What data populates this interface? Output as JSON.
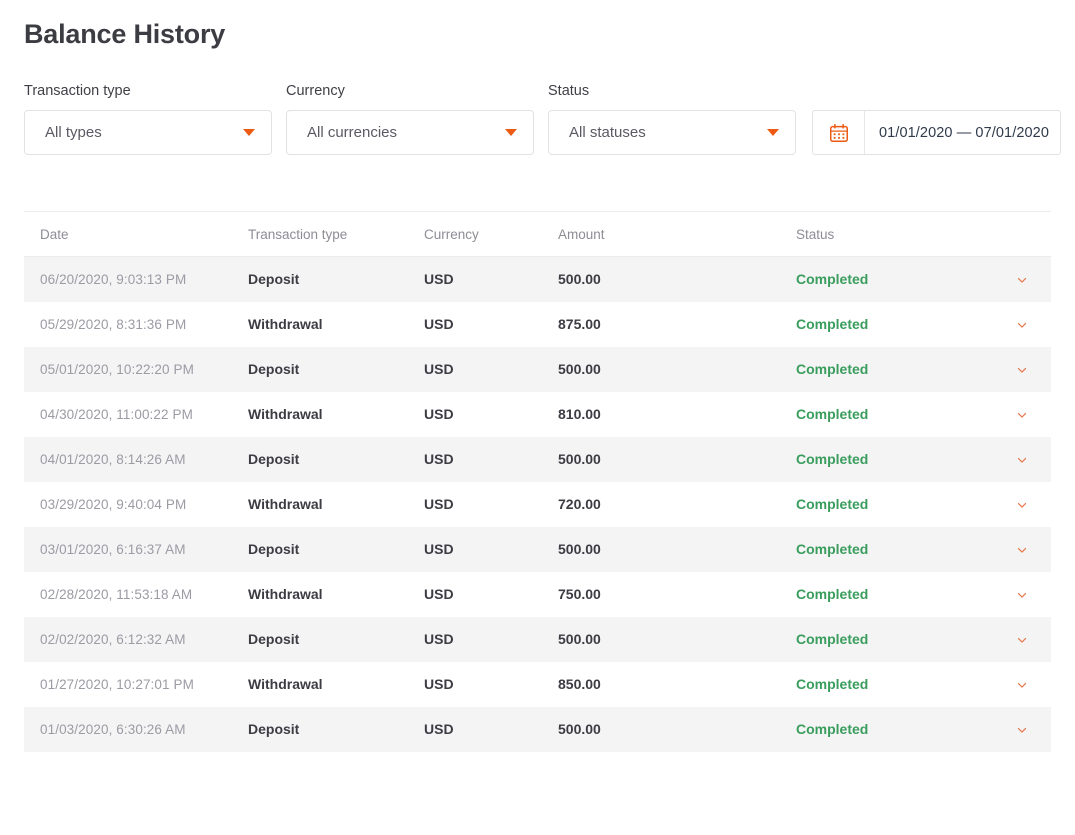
{
  "page": {
    "title": "Balance History"
  },
  "colors": {
    "accent_orange": "#ec5a13",
    "status_green": "#3a9d5d",
    "title_dark": "#3c3c43",
    "row_stripe": "#f4f4f5",
    "muted_text": "#9b9ba3"
  },
  "filters": {
    "transaction_type": {
      "label": "Transaction type",
      "value": "All types",
      "icon": "caret-down-icon"
    },
    "currency": {
      "label": "Currency",
      "value": "All currencies",
      "icon": "caret-down-icon"
    },
    "status": {
      "label": "Status",
      "value": "All statuses",
      "icon": "caret-down-icon"
    },
    "date_range": {
      "value": "01/01/2020 — 07/01/2020",
      "icon": "calendar-icon"
    }
  },
  "table": {
    "columns": [
      "Date",
      "Transaction type",
      "Currency",
      "Amount",
      "Status"
    ],
    "row_expand_icon": "chevron-down-icon",
    "rows": [
      {
        "date": "06/20/2020, 9:03:13 PM",
        "type": "Deposit",
        "currency": "USD",
        "amount": "500.00",
        "status": "Completed"
      },
      {
        "date": "05/29/2020, 8:31:36 PM",
        "type": "Withdrawal",
        "currency": "USD",
        "amount": "875.00",
        "status": "Completed"
      },
      {
        "date": "05/01/2020, 10:22:20 PM",
        "type": "Deposit",
        "currency": "USD",
        "amount": "500.00",
        "status": "Completed"
      },
      {
        "date": "04/30/2020, 11:00:22 PM",
        "type": "Withdrawal",
        "currency": "USD",
        "amount": "810.00",
        "status": "Completed"
      },
      {
        "date": "04/01/2020, 8:14:26 AM",
        "type": "Deposit",
        "currency": "USD",
        "amount": "500.00",
        "status": "Completed"
      },
      {
        "date": "03/29/2020, 9:40:04 PM",
        "type": "Withdrawal",
        "currency": "USD",
        "amount": "720.00",
        "status": "Completed"
      },
      {
        "date": "03/01/2020, 6:16:37 AM",
        "type": "Deposit",
        "currency": "USD",
        "amount": "500.00",
        "status": "Completed"
      },
      {
        "date": "02/28/2020, 11:53:18 AM",
        "type": "Withdrawal",
        "currency": "USD",
        "amount": "750.00",
        "status": "Completed"
      },
      {
        "date": "02/02/2020, 6:12:32 AM",
        "type": "Deposit",
        "currency": "USD",
        "amount": "500.00",
        "status": "Completed"
      },
      {
        "date": "01/27/2020, 10:27:01 PM",
        "type": "Withdrawal",
        "currency": "USD",
        "amount": "850.00",
        "status": "Completed"
      },
      {
        "date": "01/03/2020, 6:30:26 AM",
        "type": "Deposit",
        "currency": "USD",
        "amount": "500.00",
        "status": "Completed"
      }
    ]
  }
}
